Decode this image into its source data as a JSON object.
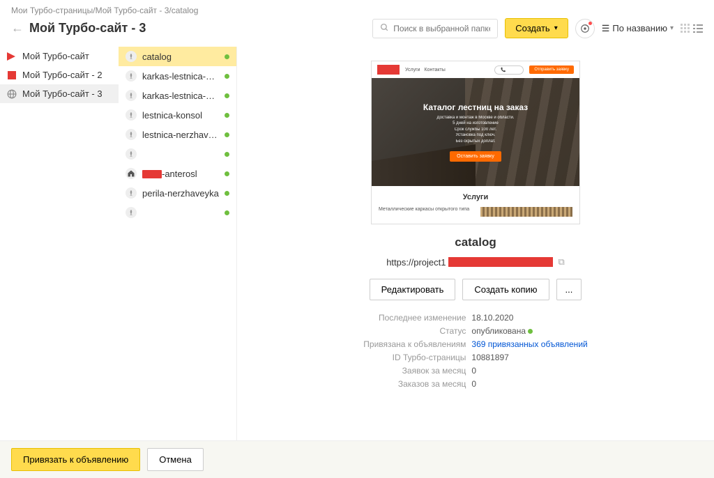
{
  "breadcrumb": "Мои Турбо-страницы/Мой Турбо-сайт - 3/catalog",
  "page_title": "Мой Турбо-сайт - 3",
  "search": {
    "placeholder": "Поиск в выбранной папке"
  },
  "create_btn": "Создать",
  "sort": {
    "label": "По названию"
  },
  "sites": [
    {
      "label": "Мой Турбо-сайт",
      "icon": "play-red"
    },
    {
      "label": "Мой Турбо-сайт - 2",
      "icon": "square-red"
    },
    {
      "label": "Мой Турбо-сайт - 3",
      "icon": "globe"
    }
  ],
  "pages": [
    {
      "label": "catalog",
      "type": "rocket",
      "status": "green",
      "selected": true
    },
    {
      "label": "karkas-lestnica-na-mon...",
      "type": "rocket",
      "status": "green"
    },
    {
      "label": "karkas-lestnica-otkrytaya",
      "type": "rocket",
      "status": "green"
    },
    {
      "label": "lestnica-konsol",
      "type": "rocket",
      "status": "green"
    },
    {
      "label": "lestnica-nerzhaveyka",
      "type": "rocket",
      "status": "green"
    },
    {
      "label": "",
      "type": "rocket",
      "status": "green",
      "redacted": true
    },
    {
      "label": "-anterosl",
      "type": "home",
      "status": "green",
      "redacted_prefix": true
    },
    {
      "label": "perila-nerzhaveyka",
      "type": "rocket",
      "status": "green"
    },
    {
      "label": "",
      "type": "rocket",
      "status": "green",
      "redacted": true
    }
  ],
  "preview": {
    "nav": [
      "Услуги",
      "Контакты"
    ],
    "cta": "Отправить заявку",
    "hero_title": "Каталог лестниц на заказ",
    "hero_sub1": "Доставка и монтаж в Москве и области.",
    "hero_sub2": "5 дней на изготовление",
    "hero_sub3": "Срок службы 100 лет.",
    "hero_sub4": "Установка под ключ.",
    "hero_sub5": "Без скрытых доплат.",
    "hero_btn": "Оставить заявку",
    "section_title": "Услуги",
    "item1": "Металлические каркасы открытого типа"
  },
  "detail": {
    "title": "catalog",
    "url_prefix": "https://project1",
    "btn_edit": "Редактировать",
    "btn_copy": "Создать копию",
    "btn_more": "...",
    "meta": [
      {
        "label": "Последнее изменение",
        "value": "18.10.2020"
      },
      {
        "label": "Статус",
        "value": "опубликована",
        "dot": true
      },
      {
        "label": "Привязана к объявлениям",
        "value": "369 привязанных объявлений",
        "link": true
      },
      {
        "label": "ID Турбо-страницы",
        "value": "10881897"
      },
      {
        "label": "Заявок за месяц",
        "value": "0"
      },
      {
        "label": "Заказов за месяц",
        "value": "0"
      }
    ]
  },
  "footer": {
    "primary": "Привязать к объявлению",
    "secondary": "Отмена"
  }
}
